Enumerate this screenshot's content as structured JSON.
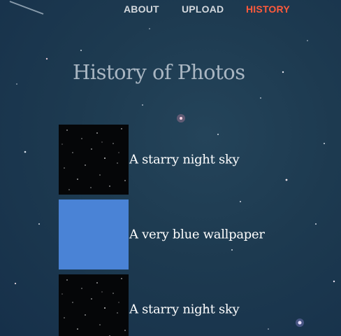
{
  "nav": {
    "items": [
      {
        "label": "ABOUT",
        "active": false
      },
      {
        "label": "UPLOAD",
        "active": false
      },
      {
        "label": "HISTORY",
        "active": true
      }
    ],
    "active_color": "#ff5a3c",
    "inactive_color": "#d3d8dd"
  },
  "page": {
    "title": "History of Photos"
  },
  "history": {
    "items": [
      {
        "caption": "A starry night sky",
        "thumbnail": "starry"
      },
      {
        "caption": "A very blue wallpaper",
        "thumbnail": "blue"
      },
      {
        "caption": "A starry night sky",
        "thumbnail": "starry"
      }
    ]
  },
  "colors": {
    "background": "#1d3a50",
    "title": "#a9b6c2",
    "caption": "#ffffff",
    "blue_thumbnail": "#4a83d6"
  }
}
